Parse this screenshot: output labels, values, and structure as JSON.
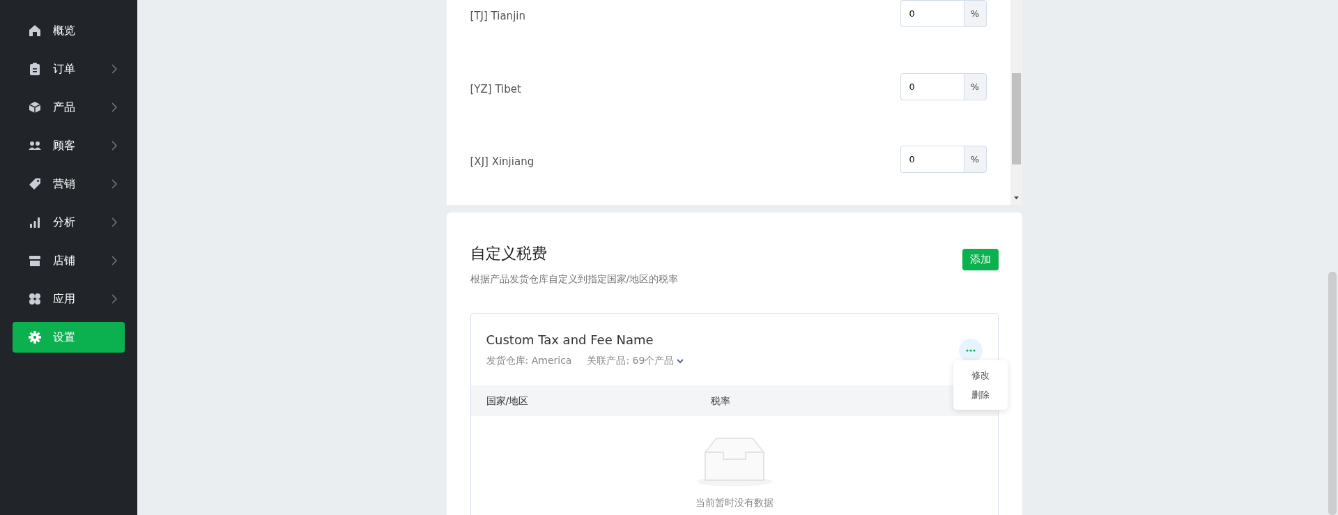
{
  "sidebar": {
    "items": [
      {
        "label": "概览",
        "expandable": false,
        "selected": false
      },
      {
        "label": "订单",
        "expandable": true,
        "selected": false
      },
      {
        "label": "产品",
        "expandable": true,
        "selected": false
      },
      {
        "label": "顾客",
        "expandable": true,
        "selected": false
      },
      {
        "label": "营销",
        "expandable": true,
        "selected": false
      },
      {
        "label": "分析",
        "expandable": true,
        "selected": false
      },
      {
        "label": "店铺",
        "expandable": true,
        "selected": false
      },
      {
        "label": "应用",
        "expandable": true,
        "selected": false
      },
      {
        "label": "设置",
        "expandable": false,
        "selected": true
      }
    ]
  },
  "region_rates": [
    {
      "region": "[TJ] Tianjin",
      "value": "0",
      "suffix": "%"
    },
    {
      "region": "[YZ] Tibet",
      "value": "0",
      "suffix": "%"
    },
    {
      "region": "[XJ] Xinjiang",
      "value": "0",
      "suffix": "%"
    }
  ],
  "custom_tax": {
    "title": "自定义税费",
    "subtitle": "根据产品发货仓库自定义到指定国家/地区的税率",
    "add_button": "添加",
    "entry": {
      "name": "Custom Tax and Fee Name",
      "warehouse": "发货仓库: America",
      "products": "关联产品: 69个产品",
      "menu": [
        "修改",
        "删除"
      ],
      "table": {
        "columns": [
          "国家/地区",
          "税率"
        ],
        "empty_text": "当前暂时没有数据"
      }
    }
  }
}
